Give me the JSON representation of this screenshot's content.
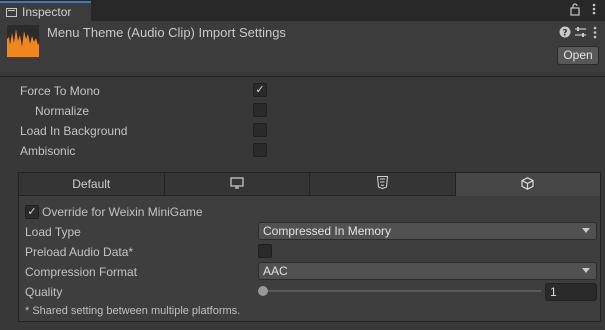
{
  "window": {
    "tab_title": "Inspector",
    "top_icons": [
      "lock-icon",
      "kebab-menu-icon"
    ]
  },
  "header": {
    "title": "Menu Theme (Audio Clip) Import Settings",
    "open_label": "Open",
    "icons": [
      "help-icon",
      "preset-sliders-icon",
      "kebab-menu-icon"
    ],
    "asset_icon": "audio-clip-icon",
    "accent_color": "#f0861e"
  },
  "settings": {
    "force_to_mono": {
      "label": "Force To Mono",
      "checked": true
    },
    "normalize": {
      "label": "Normalize",
      "checked": false
    },
    "load_in_background": {
      "label": "Load In Background",
      "checked": false
    },
    "ambisonic": {
      "label": "Ambisonic",
      "checked": false
    }
  },
  "platform_tabs": [
    {
      "label": "Default",
      "icon": null
    },
    {
      "label": "",
      "icon": "monitor-icon"
    },
    {
      "label": "",
      "icon": "html5-icon"
    },
    {
      "label": "",
      "icon": "minigame-cube-icon",
      "selected": true
    }
  ],
  "platform_settings": {
    "override": {
      "label": "Override for Weixin MiniGame",
      "checked": true
    },
    "load_type": {
      "label": "Load Type",
      "value": "Compressed In Memory"
    },
    "preload": {
      "label": "Preload Audio Data*",
      "checked": false
    },
    "compression": {
      "label": "Compression Format",
      "value": "AAC"
    },
    "quality": {
      "label": "Quality",
      "value": "1",
      "slider_fraction": 0
    },
    "note": "* Shared setting between multiple platforms."
  }
}
